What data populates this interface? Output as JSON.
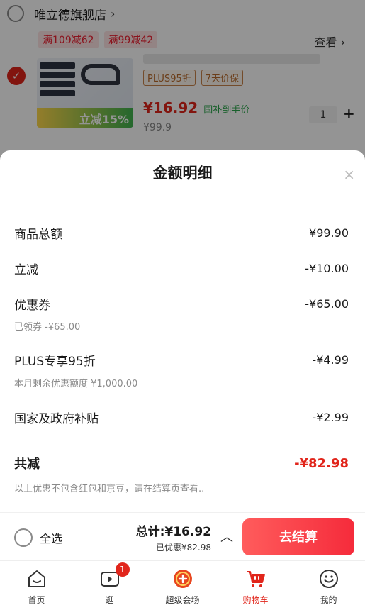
{
  "store": {
    "name": "唯立德旗舰店",
    "promos": [
      "满109减62",
      "满99减42"
    ],
    "more_label": "查看 ›"
  },
  "product": {
    "image_badge": "立减15%",
    "tags": [
      "PLUS95折",
      "7天价保"
    ],
    "price": "¥16.92",
    "price_note": "国补到手价",
    "original_price": "¥99.9",
    "quantity": "1",
    "plus_label": "+"
  },
  "sheet": {
    "title": "金额明细",
    "close_label": "×",
    "rows": [
      {
        "label": "商品总额",
        "value": "¥99.90"
      },
      {
        "label": "立减",
        "value": "-¥10.00"
      },
      {
        "label": "优惠券",
        "value": "-¥65.00",
        "sub": "已领券 -¥65.00"
      },
      {
        "label": "PLUS专享95折",
        "value": "-¥4.99",
        "sub": "本月剩余优惠额度 ¥1,000.00"
      },
      {
        "label": "国家及政府补贴",
        "value": "-¥2.99"
      }
    ],
    "total": {
      "label": "共减",
      "value": "-¥82.98"
    },
    "footnote": "以上优惠不包含红包和京豆，请在结算页查看.."
  },
  "checkout": {
    "select_all": "全选",
    "total": "总计:¥16.92",
    "saved": "已优惠¥82.98",
    "expand": "︿",
    "button": "去结算"
  },
  "tabs": [
    {
      "label": "首页",
      "icon": "home-icon"
    },
    {
      "label": "逛",
      "icon": "play-icon",
      "badge": "1"
    },
    {
      "label": "超级会场",
      "icon": "save-icon"
    },
    {
      "label": "购物车",
      "icon": "cart-icon"
    },
    {
      "label": "我的",
      "icon": "smile-icon"
    }
  ],
  "colors": {
    "accent": "#e1251b",
    "subsidy_green": "#2aa54a"
  }
}
